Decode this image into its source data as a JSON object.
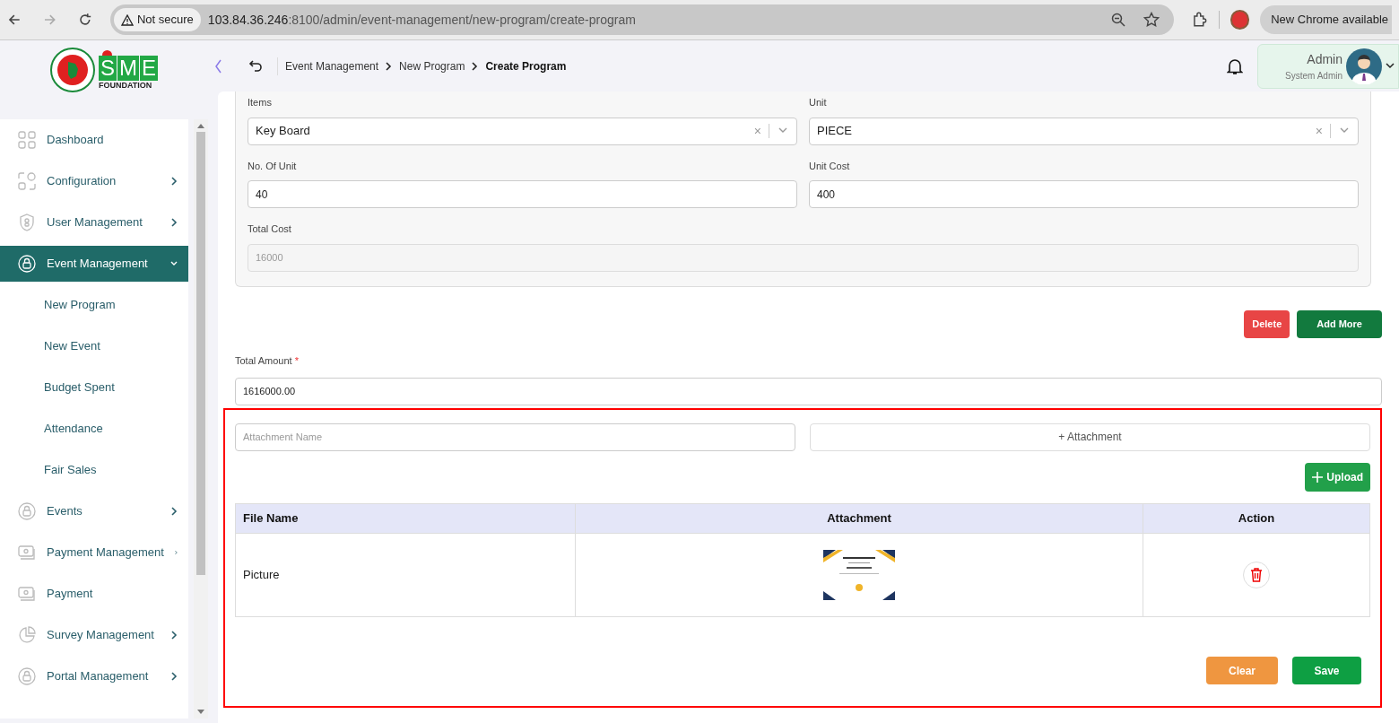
{
  "browser": {
    "security": "Not secure",
    "url_host": "103.84.36.246",
    "url_rest": ":8100/admin/event-management/new-program/create-program",
    "update": "New Chrome available"
  },
  "header": {
    "logo_text": "FOUNDATION",
    "logo_letters": [
      "S",
      "M",
      "E"
    ],
    "breadcrumbs": [
      {
        "label": "Event Management",
        "current": false
      },
      {
        "label": "New Program",
        "current": false
      },
      {
        "label": "Create Program",
        "current": true
      }
    ],
    "user": {
      "name": "Admin",
      "role": "System Admin"
    }
  },
  "sidebar": {
    "items": [
      {
        "label": "Dashboard",
        "has_arrow": false,
        "selected": false
      },
      {
        "label": "Configuration",
        "has_arrow": true,
        "selected": false,
        "expanded": false
      },
      {
        "label": "User Management",
        "has_arrow": true,
        "selected": false,
        "expanded": false
      },
      {
        "label": "Event Management",
        "has_arrow": true,
        "selected": true,
        "expanded": true,
        "children": [
          {
            "label": "New Program"
          },
          {
            "label": "New Event"
          },
          {
            "label": "Budget Spent"
          },
          {
            "label": "Attendance"
          },
          {
            "label": "Fair Sales"
          }
        ]
      },
      {
        "label": "Events",
        "has_arrow": true,
        "selected": false,
        "expanded": false
      },
      {
        "label": "Payment Management",
        "has_arrow": true,
        "selected": false,
        "expanded": false
      },
      {
        "label": "Payment",
        "has_arrow": false,
        "selected": false
      },
      {
        "label": "Survey Management",
        "has_arrow": true,
        "selected": false,
        "expanded": false
      },
      {
        "label": "Portal Management",
        "has_arrow": true,
        "selected": false,
        "expanded": false
      }
    ]
  },
  "item_card": {
    "items": {
      "label": "Items",
      "value": "Key Board",
      "clear": "×"
    },
    "unit": {
      "label": "Unit",
      "value": "PIECE",
      "clear": "×"
    },
    "no_of_unit": {
      "label": "No. Of Unit",
      "value": "40"
    },
    "unit_cost": {
      "label": "Unit Cost",
      "value": "400"
    },
    "total_cost": {
      "label": "Total Cost",
      "value": "16000",
      "disabled": true
    }
  },
  "item_buttons": [
    "Delete",
    "Add More"
  ],
  "total_amount": {
    "label": "Total Amount",
    "required_mark": "*",
    "value": "1616000.00"
  },
  "attachments": {
    "name_placeholder": "Attachment Name",
    "attach_button": "+ Attachment",
    "upload_button": "Upload",
    "columns": [
      "File Name",
      "Attachment",
      "Action"
    ],
    "rows": [
      {
        "file_name": "Picture"
      }
    ]
  },
  "form_buttons": [
    "Clear",
    "Save"
  ]
}
